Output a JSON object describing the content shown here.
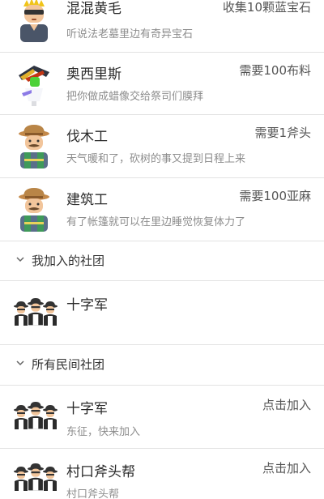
{
  "npcs": [
    {
      "name": "混混黄毛",
      "desc": "听说法老墓里边有奇异宝石",
      "quest": "收集10颗蓝宝石",
      "avatar_icon": "thug-blonde-sunglasses-icon"
    },
    {
      "name": "奥西里斯",
      "desc": "把你做成蜡像交给祭司们膜拜",
      "quest": "需要100布料",
      "avatar_icon": "pharaoh-osiris-icon"
    },
    {
      "name": "伐木工",
      "desc": "天气暖和了，砍树的事又提到日程上来",
      "quest": "需要1斧头",
      "avatar_icon": "lumberjack-icon"
    },
    {
      "name": "建筑工",
      "desc": "有了帐篷就可以在里边睡觉恢复体力了",
      "quest": "需要100亚麻",
      "avatar_icon": "builder-icon"
    }
  ],
  "my_clubs": {
    "title": "我加入的社团",
    "items": [
      {
        "name": "十字军",
        "avatar_icon": "club-members-icon"
      }
    ]
  },
  "all_clubs": {
    "title": "所有民间社团",
    "items": [
      {
        "name": "十字军",
        "desc": "东征，快来加入",
        "action": "点击加入",
        "avatar_icon": "club-members-icon"
      },
      {
        "name": "村口斧头帮",
        "desc": "村口斧头帮",
        "action": "点击加入",
        "avatar_icon": "club-members-icon"
      }
    ]
  },
  "colors": {
    "divider": "#e2e2e2",
    "title": "#2a2a2a",
    "subtitle": "#8d8d8d",
    "skin": "#f2c59b",
    "vest": "#3f9a5a",
    "hat": "#b98547"
  }
}
